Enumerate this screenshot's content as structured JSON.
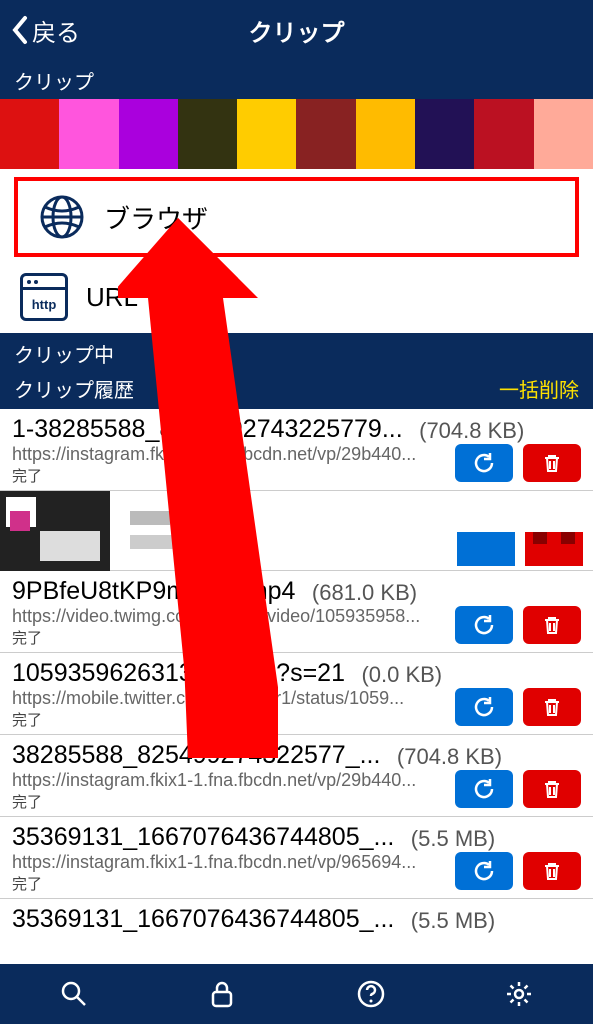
{
  "nav": {
    "back": "戻る",
    "title": "クリップ"
  },
  "section_clip_label": "クリップ",
  "options": {
    "browser": "ブラウザ",
    "url": "URL"
  },
  "section_clipping_label": "クリップ中",
  "history_header": {
    "label": "クリップ履歴",
    "delete_all": "一括削除"
  },
  "status_done": "完了",
  "items": [
    {
      "title": "1-38285588_8254992743225779...",
      "size": "(704.8 KB)",
      "url": "https://instagram.fkix1-1.fna.fbcdn.net/vp/29b440..."
    },
    {
      "thumb": true
    },
    {
      "title": "9PBfeU8tKP9mDT8l.mp4",
      "size": "(681.0 KB)",
      "url": "https://video.twimg.com/ext_tw_video/105935958..."
    },
    {
      "title": "1059359626313916416?s=21",
      "size": "(0.0 KB)",
      "url": "https://mobile.twitter.com/r04nkmr1/status/1059..."
    },
    {
      "title": "38285588_825499274322577_...",
      "size": "(704.8 KB)",
      "url": "https://instagram.fkix1-1.fna.fbcdn.net/vp/29b440..."
    },
    {
      "title": "35369131_1667076436744805_...",
      "size": "(5.5 MB)",
      "url": "https://instagram.fkix1-1.fna.fbcdn.net/vp/965694..."
    },
    {
      "title": "35369131_1667076436744805_...",
      "size": "(5.5 MB)",
      "url": ""
    }
  ],
  "http_chip": "http"
}
